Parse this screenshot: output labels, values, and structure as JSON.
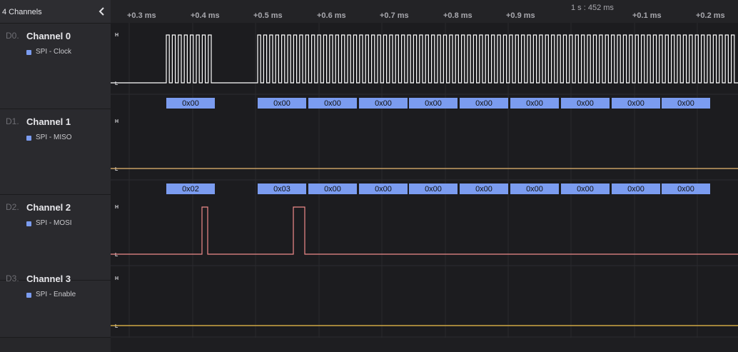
{
  "header": {
    "channel_count": "4 Channels"
  },
  "timeline": {
    "anchor": "1 s : 452 ms",
    "ticks": [
      "+0.3 ms",
      "+0.4 ms",
      "+0.5 ms",
      "+0.6 ms",
      "+0.7 ms",
      "+0.8 ms",
      "+0.9 ms",
      "+0.1 ms",
      "+0.2 ms"
    ]
  },
  "channels": [
    {
      "index": "D0.",
      "name": "Channel 0",
      "analyzer": "SPI - Clock",
      "color": "#ffffff"
    },
    {
      "index": "D1.",
      "name": "Channel 1",
      "analyzer": "SPI - MISO",
      "color": "#e8b872"
    },
    {
      "index": "D2.",
      "name": "Channel 2",
      "analyzer": "SPI - MOSI",
      "color": "#f08a8a"
    },
    {
      "index": "D3.",
      "name": "Channel 3",
      "analyzer": "SPI - Enable",
      "color": "#f2c14a"
    }
  ],
  "level_labels": {
    "high": "H",
    "low": "L"
  },
  "decoded": {
    "miso": [
      "0x00",
      "0x00",
      "0x00",
      "0x00",
      "0x00",
      "0x00",
      "0x00",
      "0x00",
      "0x00",
      "0x00"
    ],
    "mosi": [
      "0x02",
      "0x03",
      "0x00",
      "0x00",
      "0x00",
      "0x00",
      "0x00",
      "0x00",
      "0x00",
      "0x00"
    ]
  },
  "colors": {
    "accent": "#7b9cf0",
    "label_bg": "#7b9cf0",
    "label_text": "#111111"
  }
}
